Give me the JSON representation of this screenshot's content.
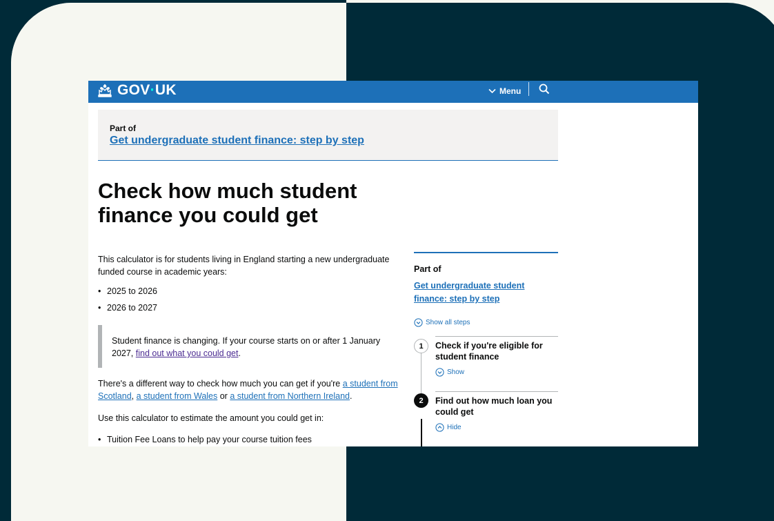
{
  "header": {
    "logo_text_a": "GOV",
    "logo_dot": "·",
    "logo_text_b": "UK",
    "menu_label": "Menu",
    "brand_color": "#1d70b8"
  },
  "part_of_banner": {
    "label": "Part of",
    "link": "Get undergraduate student finance: step by step"
  },
  "page_title": "Check how much student finance you could get",
  "intro": "This calculator is for students living in England starting a new undergraduate funded course in academic years:",
  "years": [
    "2025 to 2026",
    "2026 to 2027"
  ],
  "inset": {
    "text_before": "Student finance is changing. If your course starts on or after 1 January 2027, ",
    "link": "find out what you could get",
    "text_after": "."
  },
  "different_way": {
    "text_before": "There's a different way to check how much you can get if you're ",
    "link_scotland": "a student from Scotland",
    "sep1": ", ",
    "link_wales": "a student from Wales",
    "sep2": " or ",
    "link_ni": "a student from Northern Ireland",
    "text_after": "."
  },
  "use_calc": "Use this calculator to estimate the amount you could get in:",
  "use_list": [
    "Tuition Fee Loans to help pay your course tuition fees"
  ],
  "sidebar": {
    "part_of": "Part of",
    "link": "Get undergraduate student finance: step by step",
    "show_all": "Show all steps",
    "steps": [
      {
        "number": "1",
        "title": "Check if you're eligible for student finance",
        "toggle": "Show"
      },
      {
        "number": "2",
        "title": "Find out how much loan you could get",
        "toggle": "Hide"
      }
    ]
  }
}
